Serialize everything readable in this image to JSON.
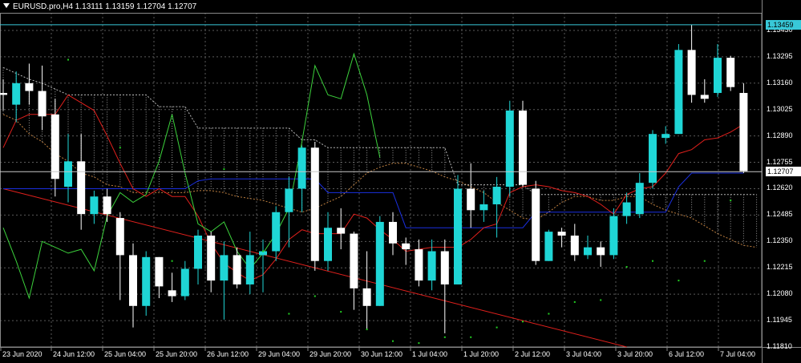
{
  "window": {
    "symbol_line": "EURUSD.pro,H4  1.13111 1.13159 1.12704 1.12707"
  },
  "price_axis": {
    "labels": [
      "1.13430",
      "1.13295",
      "1.13160",
      "1.13025",
      "1.12890",
      "1.12755",
      "1.12620",
      "1.12485",
      "1.12350",
      "1.12215",
      "1.12080",
      "1.11945",
      "1.11810"
    ],
    "ask_line_label": "1.13459",
    "bid_label": "1.12707"
  },
  "time_axis": {
    "labels": [
      "23 Jun 2020",
      "24 Jun 12:00",
      "25 Jun 04:00",
      "25 Jun 20:00",
      "26 Jun 12:00",
      "29 Jun 04:00",
      "29 Jun 20:00",
      "30 Jun 12:00",
      "1 Jul 04:00",
      "1 Jul 20:00",
      "2 Jul 12:00",
      "3 Jul 04:00",
      "3 Jul 20:00",
      "6 Jul 12:00",
      "7 Jul 04:00"
    ]
  },
  "colors": {
    "background": "#000000",
    "bull": "#1fd6d6",
    "bear": "#ffffff",
    "grid": "#5a5a5a",
    "ask_line": "#38c8d8",
    "bid_badge": "#ffffff",
    "tenkan": "#e0201c",
    "kijun": "#1a2fe0",
    "chikou": "#3cd23c",
    "senkou": "#c08040",
    "trendline": "#e0201c",
    "fractal_dots": "#22cc22"
  },
  "chart_data": {
    "type": "candlestick",
    "symbol": "EURUSD.pro",
    "timeframe": "H4",
    "ohlc_header": {
      "open": 1.13111,
      "high": 1.13159,
      "low": 1.12704,
      "close": 1.12707
    },
    "ylim": [
      1.1181,
      1.1352
    ],
    "candles": [
      {
        "o": 1.1311,
        "h": 1.1318,
        "l": 1.1302,
        "c": 1.131
      },
      {
        "o": 1.1305,
        "h": 1.1322,
        "l": 1.1296,
        "c": 1.1316
      },
      {
        "o": 1.1316,
        "h": 1.1326,
        "l": 1.1305,
        "c": 1.1312
      },
      {
        "o": 1.1312,
        "h": 1.1325,
        "l": 1.1292,
        "c": 1.1299
      },
      {
        "o": 1.13,
        "h": 1.1308,
        "l": 1.1258,
        "c": 1.1267
      },
      {
        "o": 1.1263,
        "h": 1.129,
        "l": 1.1255,
        "c": 1.1276
      },
      {
        "o": 1.1276,
        "h": 1.129,
        "l": 1.1241,
        "c": 1.1249
      },
      {
        "o": 1.1249,
        "h": 1.1261,
        "l": 1.1244,
        "c": 1.1258
      },
      {
        "o": 1.1258,
        "h": 1.1262,
        "l": 1.1245,
        "c": 1.1249
      },
      {
        "o": 1.1247,
        "h": 1.125,
        "l": 1.1205,
        "c": 1.1228
      },
      {
        "o": 1.1228,
        "h": 1.1234,
        "l": 1.1191,
        "c": 1.1202
      },
      {
        "o": 1.1202,
        "h": 1.123,
        "l": 1.1197,
        "c": 1.1227
      },
      {
        "o": 1.1227,
        "h": 1.1227,
        "l": 1.1206,
        "c": 1.1212
      },
      {
        "o": 1.121,
        "h": 1.1219,
        "l": 1.1204,
        "c": 1.1207
      },
      {
        "o": 1.1207,
        "h": 1.1225,
        "l": 1.1205,
        "c": 1.1221
      },
      {
        "o": 1.1221,
        "h": 1.1241,
        "l": 1.1213,
        "c": 1.1238
      },
      {
        "o": 1.1238,
        "h": 1.124,
        "l": 1.1209,
        "c": 1.1215
      },
      {
        "o": 1.1215,
        "h": 1.1235,
        "l": 1.1195,
        "c": 1.1228
      },
      {
        "o": 1.1228,
        "h": 1.1232,
        "l": 1.1211,
        "c": 1.1213
      },
      {
        "o": 1.1213,
        "h": 1.124,
        "l": 1.1208,
        "c": 1.1228
      },
      {
        "o": 1.1228,
        "h": 1.1236,
        "l": 1.1209,
        "c": 1.123
      },
      {
        "o": 1.123,
        "h": 1.1253,
        "l": 1.1225,
        "c": 1.125
      },
      {
        "o": 1.125,
        "h": 1.1268,
        "l": 1.1232,
        "c": 1.1262
      },
      {
        "o": 1.1262,
        "h": 1.1284,
        "l": 1.125,
        "c": 1.1283
      },
      {
        "o": 1.1283,
        "h": 1.1286,
        "l": 1.122,
        "c": 1.1225
      },
      {
        "o": 1.1225,
        "h": 1.125,
        "l": 1.122,
        "c": 1.1242
      },
      {
        "o": 1.1242,
        "h": 1.1252,
        "l": 1.1231,
        "c": 1.1239
      },
      {
        "o": 1.1239,
        "h": 1.124,
        "l": 1.12,
        "c": 1.1211
      },
      {
        "o": 1.1211,
        "h": 1.123,
        "l": 1.119,
        "c": 1.1202
      },
      {
        "o": 1.1202,
        "h": 1.1248,
        "l": 1.1202,
        "c": 1.1245
      },
      {
        "o": 1.1245,
        "h": 1.125,
        "l": 1.1228,
        "c": 1.1234
      },
      {
        "o": 1.1234,
        "h": 1.1237,
        "l": 1.1223,
        "c": 1.1231
      },
      {
        "o": 1.1231,
        "h": 1.1236,
        "l": 1.1212,
        "c": 1.1215
      },
      {
        "o": 1.1215,
        "h": 1.1236,
        "l": 1.121,
        "c": 1.123
      },
      {
        "o": 1.123,
        "h": 1.1236,
        "l": 1.1188,
        "c": 1.1213
      },
      {
        "o": 1.1213,
        "h": 1.1269,
        "l": 1.1213,
        "c": 1.1262
      },
      {
        "o": 1.1262,
        "h": 1.1275,
        "l": 1.1242,
        "c": 1.1251
      },
      {
        "o": 1.1251,
        "h": 1.1261,
        "l": 1.1245,
        "c": 1.1254
      },
      {
        "o": 1.1254,
        "h": 1.1268,
        "l": 1.1237,
        "c": 1.1263
      },
      {
        "o": 1.1263,
        "h": 1.1307,
        "l": 1.1258,
        "c": 1.1302
      },
      {
        "o": 1.1302,
        "h": 1.1307,
        "l": 1.1263,
        "c": 1.1264
      },
      {
        "o": 1.1262,
        "h": 1.1266,
        "l": 1.1223,
        "c": 1.1225
      },
      {
        "o": 1.1225,
        "h": 1.1241,
        "l": 1.1225,
        "c": 1.124
      },
      {
        "o": 1.124,
        "h": 1.1242,
        "l": 1.1232,
        "c": 1.1238
      },
      {
        "o": 1.1238,
        "h": 1.1244,
        "l": 1.1225,
        "c": 1.1228
      },
      {
        "o": 1.1228,
        "h": 1.1238,
        "l": 1.1226,
        "c": 1.1232
      },
      {
        "o": 1.1232,
        "h": 1.1235,
        "l": 1.1222,
        "c": 1.1228
      },
      {
        "o": 1.1228,
        "h": 1.1252,
        "l": 1.1226,
        "c": 1.1248
      },
      {
        "o": 1.1248,
        "h": 1.126,
        "l": 1.1244,
        "c": 1.1255
      },
      {
        "o": 1.1249,
        "h": 1.127,
        "l": 1.1247,
        "c": 1.1265
      },
      {
        "o": 1.1265,
        "h": 1.1292,
        "l": 1.1262,
        "c": 1.129
      },
      {
        "o": 1.1288,
        "h": 1.1294,
        "l": 1.1285,
        "c": 1.129
      },
      {
        "o": 1.129,
        "h": 1.1336,
        "l": 1.129,
        "c": 1.1333
      },
      {
        "o": 1.1333,
        "h": 1.1346,
        "l": 1.1306,
        "c": 1.131
      },
      {
        "o": 1.131,
        "h": 1.1318,
        "l": 1.1306,
        "c": 1.1308
      },
      {
        "o": 1.1311,
        "h": 1.1336,
        "l": 1.1309,
        "c": 1.1329
      },
      {
        "o": 1.1329,
        "h": 1.133,
        "l": 1.1312,
        "c": 1.1314
      },
      {
        "o": 1.1311,
        "h": 1.1316,
        "l": 1.127,
        "c": 1.1271
      }
    ],
    "indicators": [
      {
        "name": "tenkan",
        "values": [
          1.1283,
          1.1297,
          1.13,
          1.13,
          1.13,
          1.131,
          1.1306,
          1.1302,
          1.1289,
          1.1275,
          1.1262,
          1.1258,
          1.1262,
          1.1258,
          1.1258,
          1.1248,
          1.1234,
          1.1224,
          1.1219,
          1.1215,
          1.1218,
          1.1226,
          1.1236,
          1.1241,
          1.1239,
          1.1239,
          1.1239,
          1.1249,
          1.1247,
          1.1241,
          1.1236,
          1.123,
          1.1231,
          1.1232,
          1.1232,
          1.1232,
          1.1236,
          1.1242,
          1.1244,
          1.126,
          1.1263,
          1.1264,
          1.1263,
          1.1261,
          1.126,
          1.1258,
          1.1254,
          1.1249,
          1.1259,
          1.1262,
          1.1263,
          1.127,
          1.128,
          1.1282,
          1.1287,
          1.1288,
          1.1291,
          1.1295
        ]
      },
      {
        "name": "kijun",
        "values": [
          1.1262,
          1.1262,
          1.1262,
          1.1262,
          1.1262,
          1.1262,
          1.1262,
          1.1262,
          1.1262,
          1.1262,
          1.1262,
          1.1262,
          1.1262,
          1.1262,
          1.1262,
          1.1266,
          1.1267,
          1.1267,
          1.1267,
          1.1267,
          1.1267,
          1.1267,
          1.1267,
          1.1267,
          1.1267,
          1.126,
          1.126,
          1.126,
          1.126,
          1.126,
          1.126,
          1.1242,
          1.1242,
          1.1242,
          1.1242,
          1.1242,
          1.1242,
          1.1242,
          1.1242,
          1.1242,
          1.1242,
          1.125,
          1.125,
          1.125,
          1.125,
          1.125,
          1.125,
          1.125,
          1.125,
          1.125,
          1.125,
          1.125,
          1.1263,
          1.127,
          1.127,
          1.127,
          1.127,
          1.127
        ]
      },
      {
        "name": "chikou",
        "values": [
          1.1242,
          1.1225,
          1.1206,
          1.1235,
          1.1232,
          1.1229,
          1.1231,
          1.122,
          1.1248,
          1.126,
          1.1255,
          1.1259,
          1.1276,
          1.13,
          1.127,
          1.1244,
          1.124,
          1.1245,
          1.123,
          1.1221,
          1.1229,
          1.1239,
          1.1252,
          1.1286,
          1.1325,
          1.131,
          1.1308,
          1.1331,
          1.131,
          1.1278
        ]
      },
      {
        "name": "senkou_a",
        "values": [
          1.13,
          1.1297,
          1.129,
          1.1286,
          1.128,
          1.1276,
          1.127,
          1.1268,
          1.1264,
          1.1263,
          1.126,
          1.126,
          1.126,
          1.126,
          1.126,
          1.1261,
          1.1261,
          1.126,
          1.1258,
          1.1257,
          1.1256,
          1.1254,
          1.1252,
          1.125,
          1.1252,
          1.1255,
          1.1258,
          1.1264,
          1.127,
          1.1273,
          1.1275,
          1.1275,
          1.1273,
          1.1271,
          1.1268,
          1.1266,
          1.1263,
          1.126,
          1.1255,
          1.1251,
          1.1247,
          1.1246,
          1.125,
          1.1255,
          1.1258,
          1.1258,
          1.1256,
          1.1256,
          1.1258,
          1.1258,
          1.1254,
          1.1251,
          1.1249,
          1.1247,
          1.1243,
          1.1239,
          1.1236,
          1.1233,
          1.1232
        ]
      },
      {
        "name": "senkou_b",
        "values": [
          1.1324,
          1.1321,
          1.1318,
          1.1316,
          1.1313,
          1.131,
          1.131,
          1.131,
          1.131,
          1.131,
          1.131,
          1.131,
          1.1304,
          1.1304,
          1.1304,
          1.1293,
          1.1293,
          1.1293,
          1.1293,
          1.1293,
          1.1293,
          1.1293,
          1.1293,
          1.1287,
          1.1287,
          1.1283,
          1.1283,
          1.1283,
          1.1283,
          1.1283,
          1.1283,
          1.1283,
          1.1283,
          1.1283,
          1.1283,
          1.1264,
          1.1264,
          1.1264,
          1.1264,
          1.1264,
          1.1264,
          1.1259,
          1.1259,
          1.1259,
          1.1259,
          1.1259,
          1.1259,
          1.1259,
          1.1259,
          1.1259,
          1.1259,
          1.1259,
          1.1259,
          1.1259,
          1.1259,
          1.1259,
          1.1259,
          1.1259,
          1.1259
        ]
      }
    ],
    "trendline": [
      [
        1.1262,
        0
      ],
      [
        1.1181,
        48
      ]
    ],
    "fractal_dots": [
      {
        "i": 5,
        "p": 1.1328
      },
      {
        "i": 9,
        "p": 1.1283
      },
      {
        "i": 13,
        "p": 1.1225
      },
      {
        "i": 17,
        "p": 1.1272
      },
      {
        "i": 20,
        "p": 1.123
      },
      {
        "i": 22,
        "p": 1.1198
      },
      {
        "i": 24,
        "p": 1.1207
      },
      {
        "i": 26,
        "p": 1.1199
      },
      {
        "i": 28,
        "p": 1.119
      },
      {
        "i": 30,
        "p": 1.1184
      },
      {
        "i": 32,
        "p": 1.1183
      },
      {
        "i": 34,
        "p": 1.1186
      },
      {
        "i": 36,
        "p": 1.1186
      },
      {
        "i": 38,
        "p": 1.1191
      },
      {
        "i": 40,
        "p": 1.1194
      },
      {
        "i": 42,
        "p": 1.1198
      },
      {
        "i": 44,
        "p": 1.1204
      },
      {
        "i": 46,
        "p": 1.1205
      },
      {
        "i": 48,
        "p": 1.1222
      },
      {
        "i": 50,
        "p": 1.1225
      },
      {
        "i": 52,
        "p": 1.1215
      },
      {
        "i": 54,
        "p": 1.1225
      },
      {
        "i": 56,
        "p": 1.1256
      }
    ],
    "ask_price": 1.13459,
    "bid_price": 1.12707,
    "grid": true
  }
}
